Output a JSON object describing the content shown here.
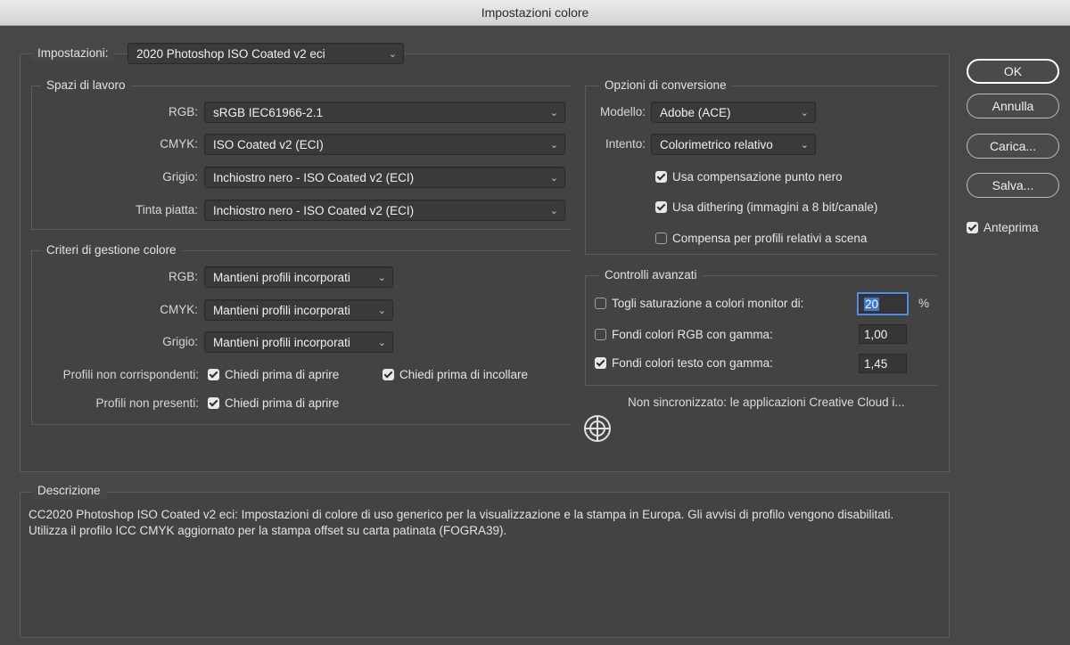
{
  "window": {
    "title": "Impostazioni colore"
  },
  "settings": {
    "label": "Impostazioni:",
    "value": "2020 Photoshop ISO Coated v2 eci"
  },
  "working_spaces": {
    "legend": "Spazi di lavoro",
    "rgb": {
      "label": "RGB:",
      "value": "sRGB IEC61966-2.1"
    },
    "cmyk": {
      "label": "CMYK:",
      "value": "ISO Coated v2 (ECI)"
    },
    "gray": {
      "label": "Grigio:",
      "value": "Inchiostro nero - ISO Coated v2 (ECI)"
    },
    "spot": {
      "label": "Tinta piatta:",
      "value": "Inchiostro nero - ISO Coated v2 (ECI)"
    }
  },
  "policies": {
    "legend": "Criteri di gestione colore",
    "rgb": {
      "label": "RGB:",
      "value": "Mantieni profili incorporati"
    },
    "cmyk": {
      "label": "CMYK:",
      "value": "Mantieni profili incorporati"
    },
    "gray": {
      "label": "Grigio:",
      "value": "Mantieni profili incorporati"
    },
    "mismatch": {
      "label": "Profili non corrispondenti:",
      "ask_open": "Chiedi prima di aprire",
      "ask_paste": "Chiedi prima di incollare"
    },
    "missing": {
      "label": "Profili non presenti:",
      "ask_open": "Chiedi prima di aprire"
    }
  },
  "conversion": {
    "legend": "Opzioni di conversione",
    "engine": {
      "label": "Modello:",
      "value": "Adobe (ACE)"
    },
    "intent": {
      "label": "Intento:",
      "value": "Colorimetrico relativo"
    },
    "black_point": "Usa compensazione punto nero",
    "dither": "Usa dithering (immagini a 8 bit/canale)",
    "scene_referred": "Compensa per profili relativi a scena"
  },
  "advanced": {
    "legend": "Controlli avanzati",
    "desaturate": {
      "label": "Togli saturazione a colori monitor di:",
      "value": "20",
      "unit": "%"
    },
    "blend_rgb": {
      "label": "Fondi colori RGB con gamma:",
      "value": "1,00"
    },
    "blend_text": {
      "label": "Fondi colori testo con gamma:",
      "value": "1,45"
    }
  },
  "sync_status": "Non sincronizzato: le applicazioni Creative Cloud i...",
  "buttons": {
    "ok": "OK",
    "cancel": "Annulla",
    "load": "Carica...",
    "save": "Salva..."
  },
  "preview": "Anteprima",
  "description": {
    "legend": "Descrizione",
    "text": "CC2020 Photoshop ISO Coated v2 eci:  Impostazioni di colore di uso generico per la visualizzazione e la stampa in Europa. Gli avvisi di profilo vengono disabilitati. Utilizza il profilo ICC CMYK aggiornato per la stampa offset su carta patinata (FOGRA39)."
  },
  "icons": {
    "sync": "sync-status-icon",
    "chevron": "chevron-down-icon",
    "checkbox": "checkmark-icon"
  }
}
